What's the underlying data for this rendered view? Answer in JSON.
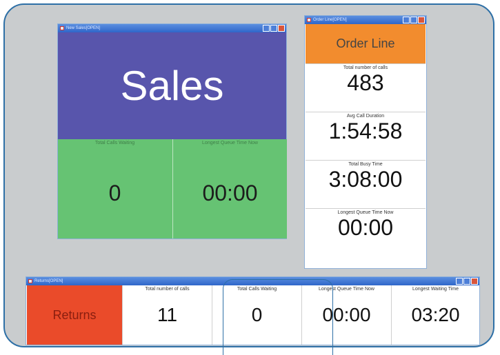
{
  "sales_window": {
    "title": "New Sales[OPEN]",
    "header": "Sales",
    "cells": [
      {
        "label": "Total Calls Waiting",
        "value": "0"
      },
      {
        "label": "Longest Queue Time Now",
        "value": "00:00"
      }
    ]
  },
  "order_window": {
    "title": "Order Line[OPEN]",
    "header": "Order Line",
    "stats": [
      {
        "label": "Total number of calls",
        "value": "483"
      },
      {
        "label": "Avg Call Duration",
        "value": "1:54:58"
      },
      {
        "label": "Total Busy Time",
        "value": "3:08:00"
      },
      {
        "label": "Longest Queue Time Now",
        "value": "00:00"
      }
    ]
  },
  "returns_window": {
    "title": "Returns[OPEN]",
    "header": "Returns",
    "stats": [
      {
        "label": "Total number of calls",
        "value": "11"
      },
      {
        "label": "Total Calls Waiting",
        "value": "0"
      },
      {
        "label": "Longest Queue Time Now",
        "value": "00:00"
      },
      {
        "label": "Longest Waiting Time",
        "value": "03:20"
      }
    ]
  },
  "colors": {
    "sales_header": "#5855ac",
    "sales_cells": "#66c373",
    "order_header": "#f28c2e",
    "returns_header": "#ea4b2a",
    "frame_border": "#2d6fa6"
  },
  "icons": [
    "window-icon",
    "minimize-icon",
    "maximize-icon",
    "close-icon"
  ]
}
